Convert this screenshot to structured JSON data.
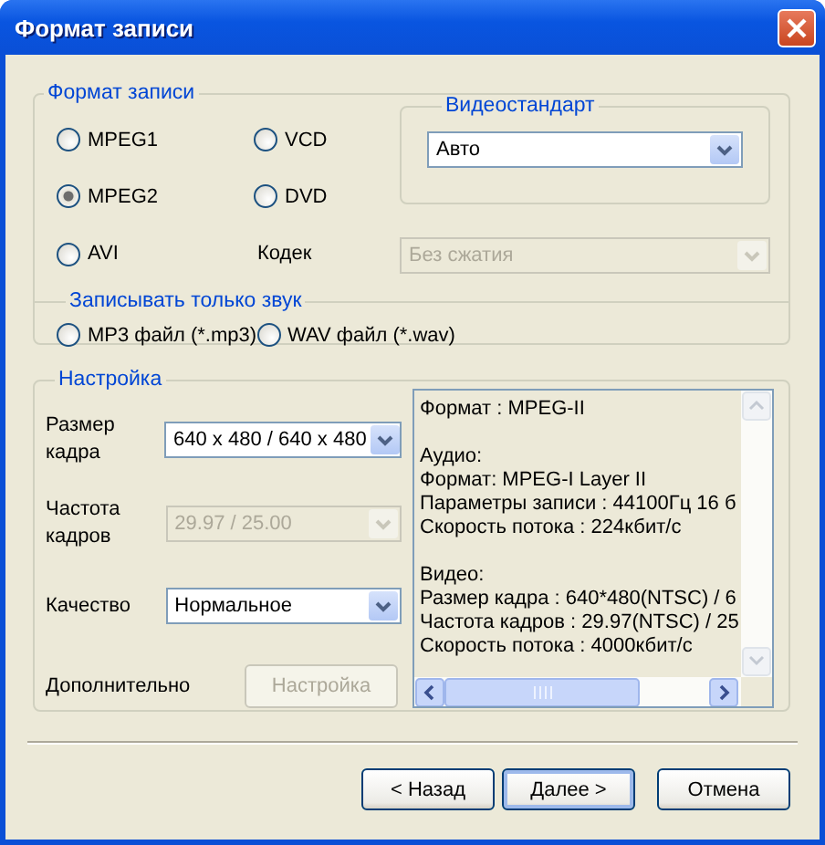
{
  "window": {
    "title": "Формат записи"
  },
  "format_group": {
    "legend": "Формат записи",
    "options": [
      {
        "label": "MPEG1",
        "selected": false
      },
      {
        "label": "VCD",
        "selected": false
      },
      {
        "label": "MPEG2",
        "selected": true
      },
      {
        "label": "DVD",
        "selected": false
      },
      {
        "label": "AVI",
        "selected": false
      }
    ],
    "video_standard": {
      "legend": "Видеостандарт",
      "value": "Авто",
      "disabled": false
    },
    "codec": {
      "label": "Кодек",
      "value": "Без сжатия",
      "disabled": true
    }
  },
  "audio_only": {
    "legend": "Записывать только звук",
    "options": [
      {
        "label": "MP3 файл (*.mp3)",
        "selected": false
      },
      {
        "label": "WAV файл (*.wav)",
        "selected": false
      }
    ]
  },
  "settings": {
    "legend": "Настройка",
    "fields": [
      {
        "label": "Размер кадра",
        "value": "640 x 480 / 640 x 480",
        "disabled": false
      },
      {
        "label": "Частота кадров",
        "value": "29.97 / 25.00",
        "disabled": true
      },
      {
        "label": "Качество",
        "value": "Нормальное",
        "disabled": false
      }
    ],
    "extra": {
      "label": "Дополнительно",
      "button": "Настройка",
      "disabled": true
    },
    "info": [
      [
        "Формат : MPEG-II"
      ],
      [
        "Аудио:",
        "Формат: MPEG-I Layer II",
        "Параметры записи : 44100Гц 16 б",
        "Скорость потока : 224кбит/с"
      ],
      [
        "Видео:",
        "Размер кадра : 640*480(NTSC) / 6",
        "Частота кадров : 29.97(NTSC) / 25",
        "Скорость потока : 4000кбит/с"
      ]
    ]
  },
  "buttons": [
    {
      "label": "< Назад",
      "default": false
    },
    {
      "label": "Далее >",
      "default": true
    },
    {
      "label": "Отмена",
      "default": false
    }
  ]
}
